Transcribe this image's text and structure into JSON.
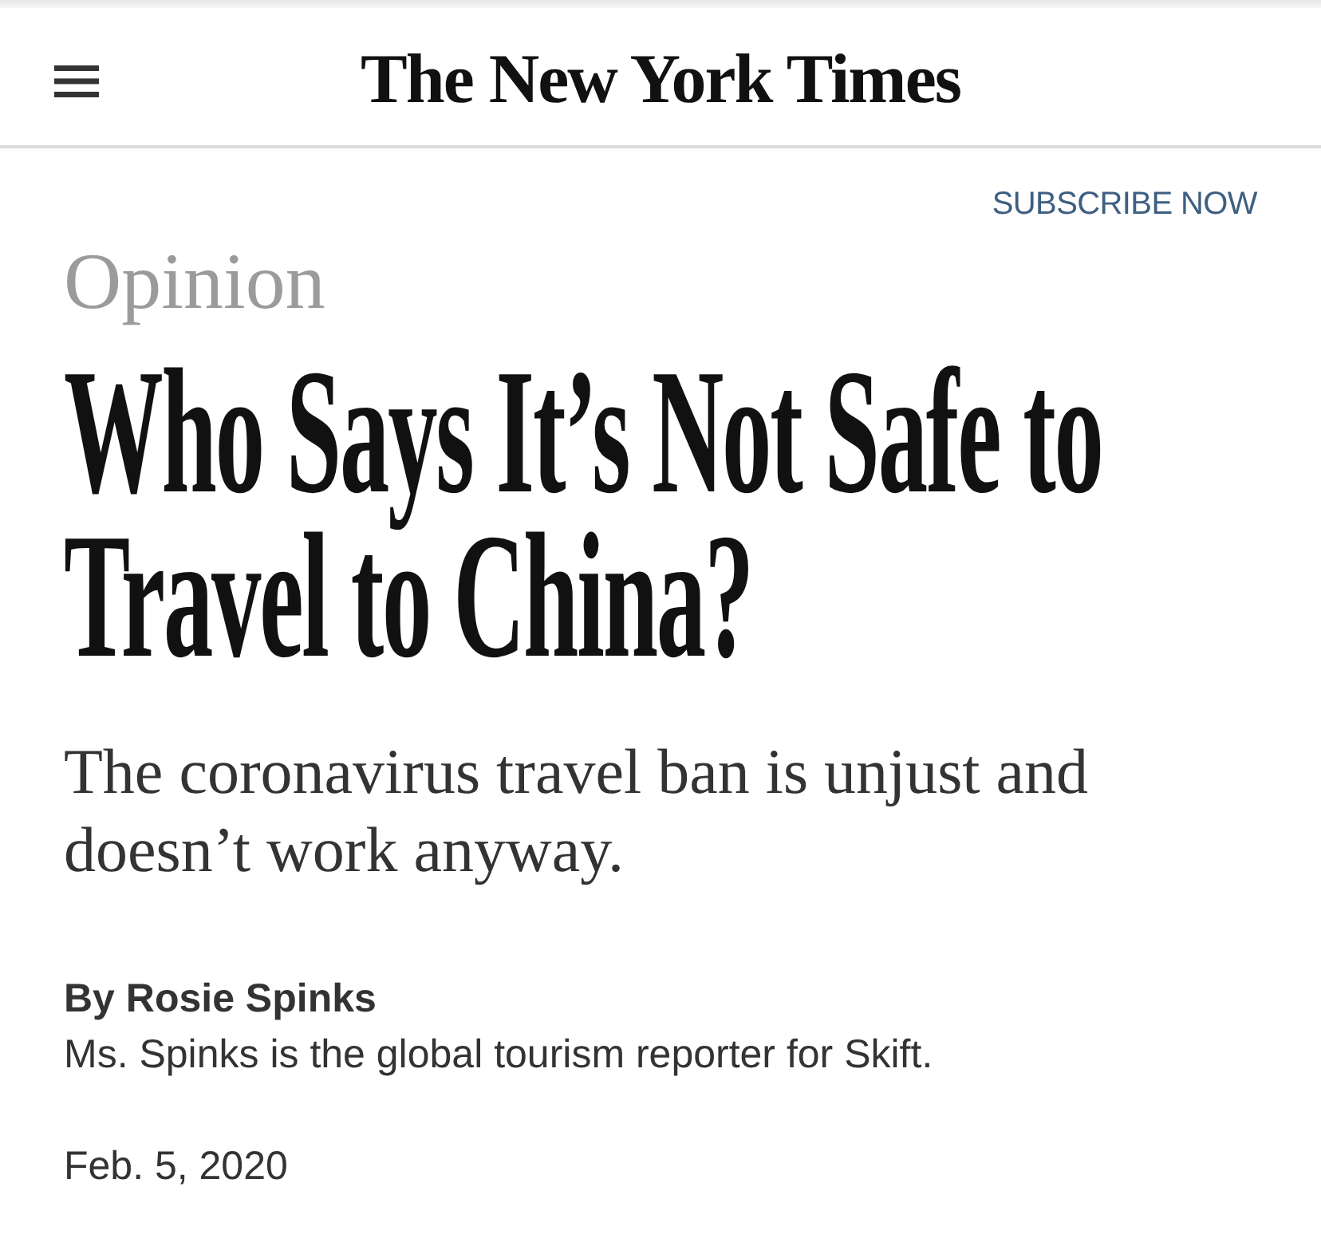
{
  "header": {
    "logo": "The New York Times"
  },
  "subscribe_link": "SUBSCRIBE NOW",
  "article": {
    "section": "Opinion",
    "headline": "Who Says It’s Not Safe to Travel to China?",
    "summary": "The coronavirus travel ban is unjust and doesn’t work anyway.",
    "byline": "By Rosie Spinks",
    "author_bio": "Ms. Spinks is the global tourism reporter for Skift.",
    "date": "Feb. 5, 2020"
  }
}
